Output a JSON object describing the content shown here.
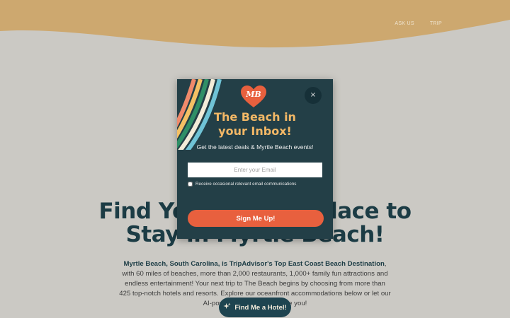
{
  "colors": {
    "page_bg": "#cbc9c4",
    "sand_wave": "#cda86f",
    "brand_teal": "#1c3c45",
    "modal_bg": "#233f47",
    "modal_title": "#f3b866",
    "signup_orange": "#e8603e",
    "logo_heart": "#e8603e"
  },
  "topnav": {
    "items": [
      "ASK US",
      "TRIP"
    ]
  },
  "hero": {
    "title_line1": "Find Your Perfect Place to",
    "title_line2": "Stay in Myrtle Beach!",
    "body_bold": "Myrtle Beach, South Carolina, is TripAdvisor's Top East Coast Beach Destination",
    "body_rest": ", with 60 miles of beaches, more than 2,000 restaurants, 1,000+ family fun attractions and endless entertainment! Your next trip to The Beach begins by choosing from more than 425 top-notch hotels and resorts. Explore our oceanfront accommodations below or let our AI-powered trip planner guide you!",
    "cta_label": "Find Me a Hotel!",
    "cta_icon": "sparkle-icon"
  },
  "modal": {
    "logo_text": "MB",
    "logo_icon": "heart-logo-icon",
    "close_symbol": "×",
    "title_line1": "The Beach in",
    "title_line2": "your Inbox!",
    "subtitle": "Get the latest deals & Myrtle Beach events!",
    "email_placeholder": "Enter your Email",
    "email_value": "",
    "consent_label": "Receive occasional relevant email communications",
    "consent_checked": false,
    "signup_label": "Sign Me Up!"
  }
}
